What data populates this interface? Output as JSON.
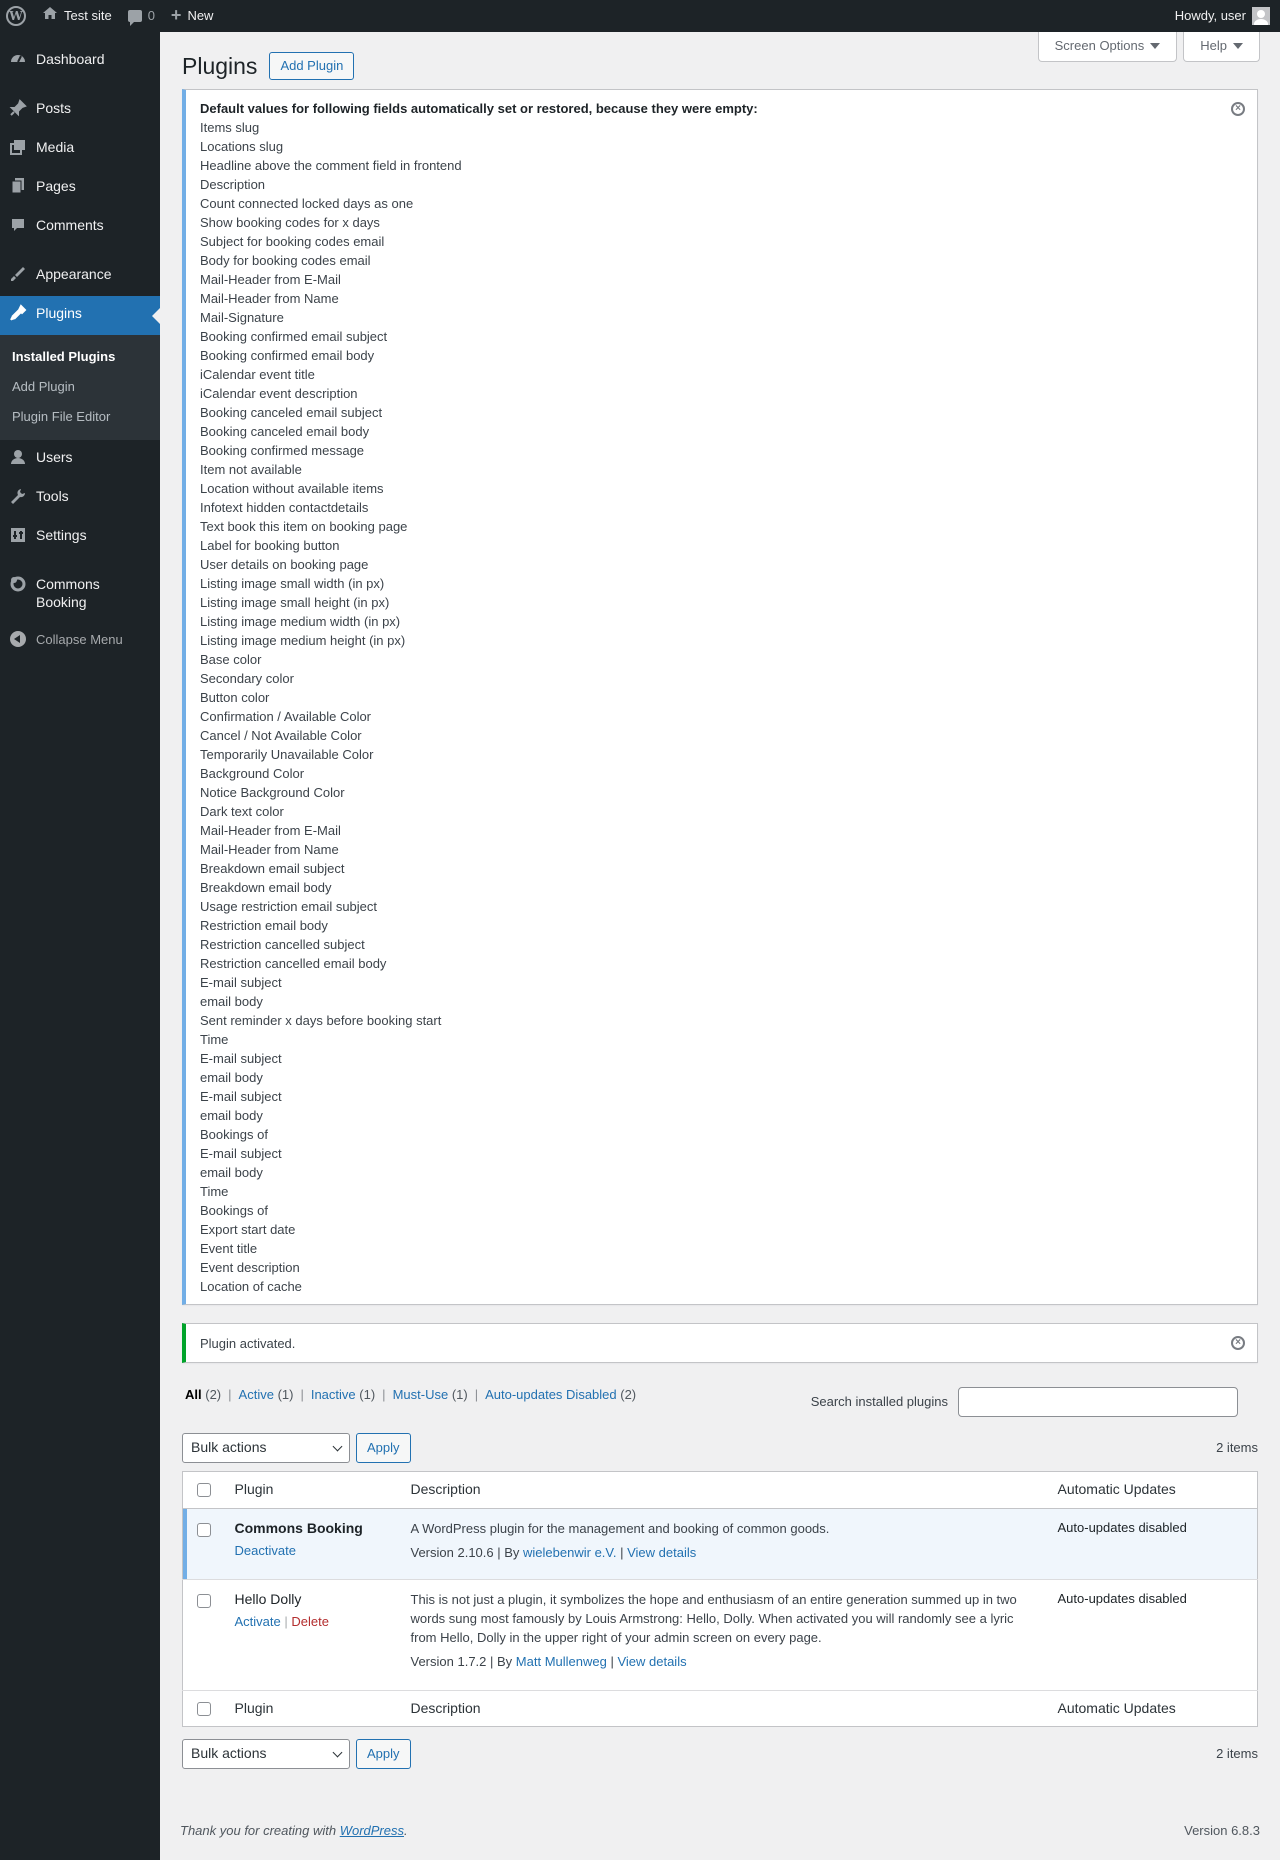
{
  "adminbar": {
    "site_name": "Test site",
    "comments_count": "0",
    "new_label": "New",
    "howdy": "Howdy, user"
  },
  "sidebar": {
    "items": [
      {
        "label": "Dashboard",
        "icon": "dashboard-icon"
      },
      {
        "label": "Posts",
        "icon": "pin-icon"
      },
      {
        "label": "Media",
        "icon": "media-icon"
      },
      {
        "label": "Pages",
        "icon": "pages-icon"
      },
      {
        "label": "Comments",
        "icon": "comment-icon"
      },
      {
        "label": "Appearance",
        "icon": "brush-icon"
      },
      {
        "label": "Plugins",
        "icon": "plugin-icon"
      },
      {
        "label": "Users",
        "icon": "user-icon"
      },
      {
        "label": "Tools",
        "icon": "wrench-icon"
      },
      {
        "label": "Settings",
        "icon": "settings-icon"
      },
      {
        "label": "Commons Booking",
        "icon": "commons-booking-icon"
      }
    ],
    "submenu": [
      "Installed Plugins",
      "Add Plugin",
      "Plugin File Editor"
    ],
    "collapse_label": "Collapse Menu"
  },
  "screen_meta": {
    "screen_options": "Screen Options",
    "help": "Help"
  },
  "page": {
    "title": "Plugins",
    "add_button": "Add Plugin"
  },
  "notice_defaults": {
    "heading": "Default values for following fields automatically set or restored, because they were empty:",
    "fields": [
      "Items slug",
      "Locations slug",
      "Headline above the comment field in frontend",
      "Description",
      "Count connected locked days as one",
      "Show booking codes for x days",
      "Subject for booking codes email",
      "Body for booking codes email",
      "Mail-Header from E-Mail",
      "Mail-Header from Name",
      "Mail-Signature",
      "Booking confirmed email subject",
      "Booking confirmed email body",
      "iCalendar event title",
      "iCalendar event description",
      "Booking canceled email subject",
      "Booking canceled email body",
      "Booking confirmed message",
      "Item not available",
      "Location without available items",
      "Infotext hidden contactdetails",
      "Text book this item on booking page",
      "Label for booking button",
      "User details on booking page",
      "Listing image small width (in px)",
      "Listing image small height (in px)",
      "Listing image medium width (in px)",
      "Listing image medium height (in px)",
      "Base color",
      "Secondary color",
      "Button color",
      "Confirmation / Available Color",
      "Cancel / Not Available Color",
      "Temporarily Unavailable Color",
      "Background Color",
      "Notice Background Color",
      "Dark text color",
      "Mail-Header from E-Mail",
      "Mail-Header from Name",
      "Breakdown email subject",
      "Breakdown email body",
      "Usage restriction email subject",
      "Restriction email body",
      "Restriction cancelled subject",
      "Restriction cancelled email body",
      "E-mail subject",
      "email body",
      "Sent reminder x days before booking start",
      "Time",
      "E-mail subject",
      "email body",
      "E-mail subject",
      "email body",
      "Bookings of",
      "E-mail subject",
      "email body",
      "Time",
      "Bookings of",
      "Export start date",
      "Event title",
      "Event description",
      "Location of cache"
    ]
  },
  "notice_activated": {
    "text": "Plugin activated."
  },
  "filters": [
    {
      "label": "All",
      "count": "(2)",
      "current": true
    },
    {
      "label": "Active",
      "count": "(1)"
    },
    {
      "label": "Inactive",
      "count": "(1)"
    },
    {
      "label": "Must-Use",
      "count": "(1)"
    },
    {
      "label": "Auto-updates Disabled",
      "count": "(2)"
    }
  ],
  "search": {
    "label": "Search installed plugins",
    "value": ""
  },
  "tablenav": {
    "bulk_label": "Bulk actions",
    "apply_label": "Apply",
    "items_count": "2 items"
  },
  "table": {
    "columns": [
      "Plugin",
      "Description",
      "Automatic Updates"
    ],
    "rows": [
      {
        "name": "Commons Booking",
        "actions": [
          "Deactivate"
        ],
        "description": "A WordPress plugin for the management and booking of common goods.",
        "version": "Version 2.10.6",
        "by_label": "By",
        "author": "wielebenwir e.V.",
        "details": "View details",
        "auto_updates": "Auto-updates disabled"
      },
      {
        "name": "Hello Dolly",
        "actions": [
          "Activate",
          "Delete"
        ],
        "description": "This is not just a plugin, it symbolizes the hope and enthusiasm of an entire generation summed up in two words sung most famously by Louis Armstrong: Hello, Dolly. When activated you will randomly see a lyric from Hello, Dolly in the upper right of your admin screen on every page.",
        "version": "Version 1.7.2",
        "by_label": "By",
        "author": "Matt Mullenweg",
        "details": "View details",
        "auto_updates": "Auto-updates disabled"
      }
    ]
  },
  "footer": {
    "thanks_prefix": "Thank you for creating with",
    "wp_link": "WordPress",
    "thanks_suffix": ".",
    "version": "Version 6.8.3"
  }
}
